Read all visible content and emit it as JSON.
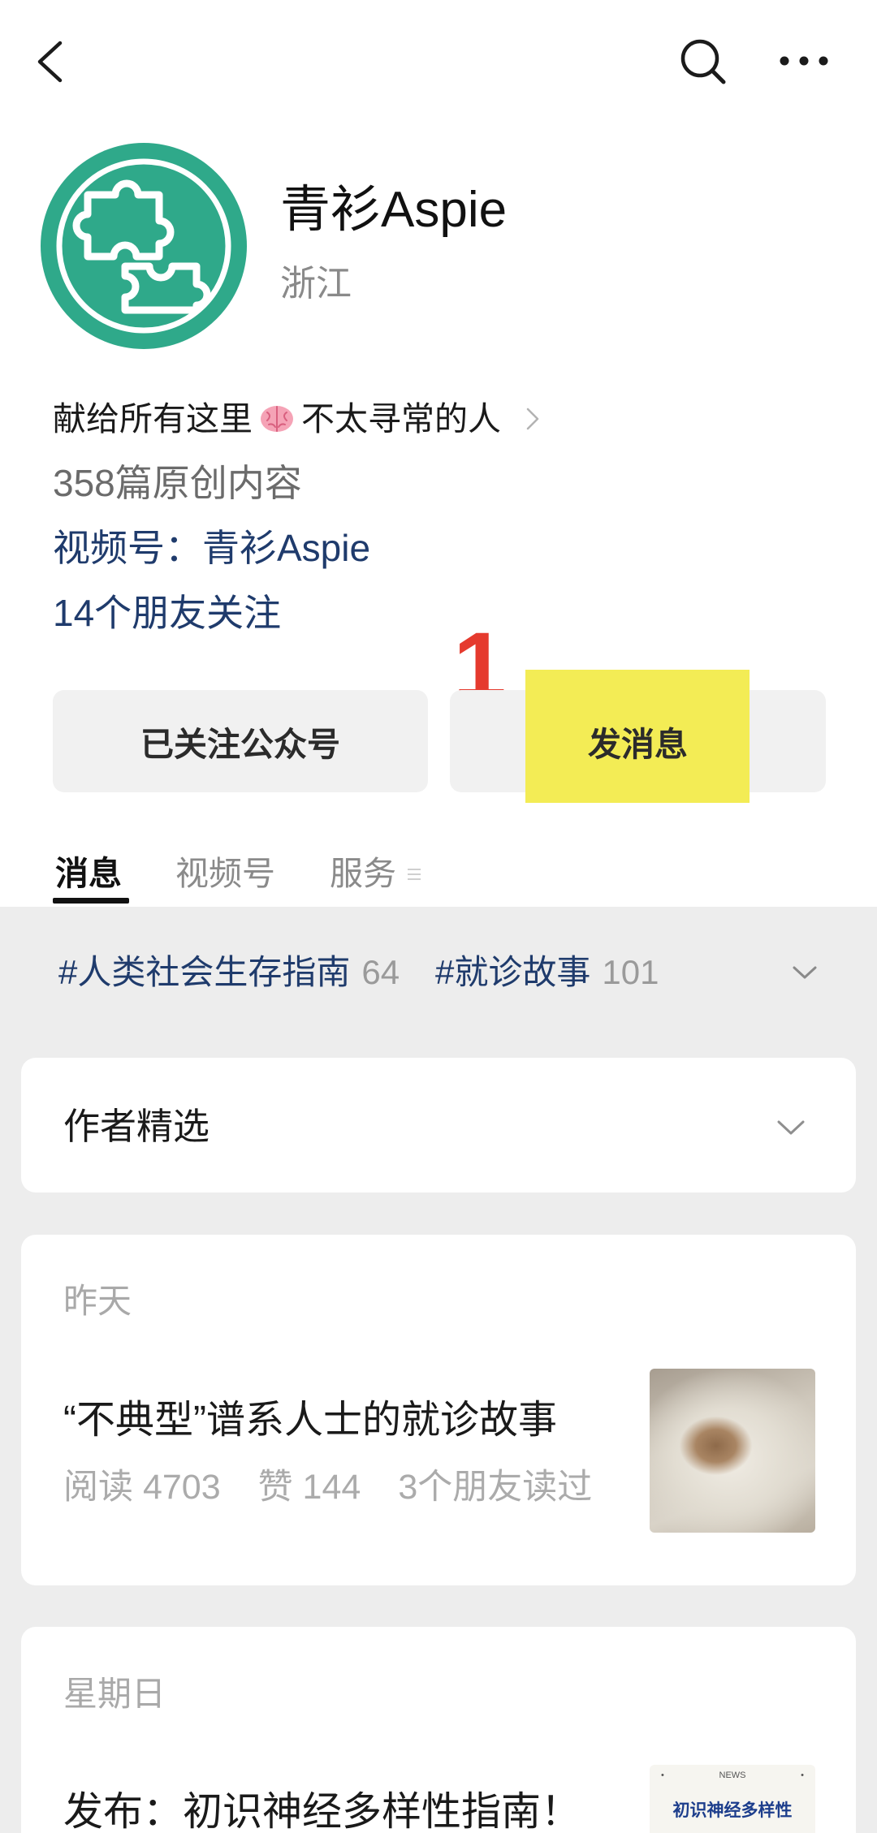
{
  "nav": {
    "back_icon": "chevron-left-icon",
    "search_icon": "search-icon",
    "more_icon": "more-dots-icon"
  },
  "profile": {
    "avatar_icon": "puzzle-logo-icon",
    "name": "青衫Aspie",
    "location": "浙江",
    "bio_prefix": "献给所有这里",
    "bio_emoji": "brain-icon",
    "bio_suffix": "不太寻常的人",
    "original_count": "358篇原创内容",
    "channel": "视频号：青衫Aspie",
    "friends_following": "14个朋友关注"
  },
  "annotation": {
    "step_label": "1"
  },
  "actions": {
    "follow_label": "已关注公众号",
    "message_label": "发消息"
  },
  "tabs": [
    {
      "label": "消息",
      "active": true
    },
    {
      "label": "视频号",
      "active": false
    },
    {
      "label": "服务",
      "active": false,
      "icon": "menu-icon"
    }
  ],
  "tags": [
    {
      "name": "#人类社会生存指南",
      "count": "64"
    },
    {
      "name": "#就诊故事",
      "count": "101"
    }
  ],
  "featured": {
    "label": "作者精选",
    "icon": "chevron-down-icon"
  },
  "articles": [
    {
      "date": "昨天",
      "title": "“不典型”谱系人士的就诊故事",
      "reads": "阅读 4703",
      "likes": "赞 144",
      "friends_read": "3个朋友读过"
    },
    {
      "date": "星期日",
      "title": "发布：初识神经多样性指南！",
      "thumbnail": {
        "badge": "NEWS",
        "title": "初识神经多样性"
      }
    }
  ],
  "colors": {
    "avatar": "#2fa98a",
    "link": "#1f3b6c",
    "annotation_red": "#e53a2e",
    "annotation_highlight": "#f3ec55",
    "page_background": "#ededed",
    "card": "#ffffff",
    "button": "#f1f1f1"
  }
}
